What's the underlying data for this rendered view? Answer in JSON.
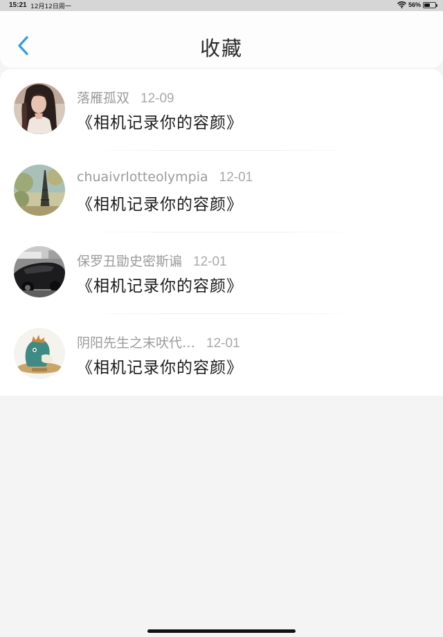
{
  "status_bar": {
    "time": "15:21",
    "date": "12月12日周一",
    "battery_percent": "56%",
    "battery_level": 0.56,
    "icons": [
      "wifi-icon",
      "battery-icon"
    ]
  },
  "header": {
    "title": "收藏",
    "back_icon": "chevron-left-icon",
    "accent_color": "#2f9bea"
  },
  "favorites": [
    {
      "user": "落雁孤双",
      "date": "12-09",
      "title": "《相机记录你的容颜》",
      "avatar": "woman-portrait"
    },
    {
      "user": "chuaivrlotteolympia",
      "date": "12-01",
      "title": "《相机记录你的容颜》",
      "avatar": "eiffel-tower"
    },
    {
      "user": "保罗丑勖史密斯谝",
      "date": "12-01",
      "title": "《相机记录你的容颜》",
      "avatar": "sports-car"
    },
    {
      "user": "阴阳先生之末吠代…",
      "date": "12-01",
      "title": "《相机记录你的容颜》",
      "avatar": "cartoon-creature"
    }
  ]
}
